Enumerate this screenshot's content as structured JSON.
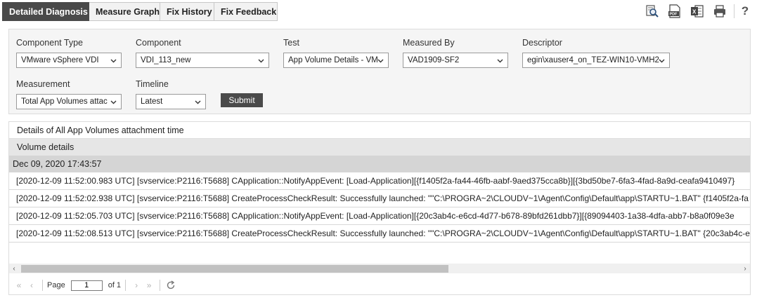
{
  "tabs": [
    {
      "label": "Detailed Diagnosis",
      "active": true
    },
    {
      "label": "Measure Graph",
      "active": false
    },
    {
      "label": "Fix History",
      "active": false
    },
    {
      "label": "Fix Feedback",
      "active": false
    }
  ],
  "toolbar": {
    "icons": [
      "search-report-icon",
      "pdf-icon",
      "excel-icon",
      "print-icon",
      "help-icon"
    ],
    "help_label": "?"
  },
  "filters": {
    "component_type": {
      "label": "Component Type",
      "value": "VMware vSphere VDI"
    },
    "component": {
      "label": "Component",
      "value": "VDI_113_new"
    },
    "test": {
      "label": "Test",
      "value": "App Volume Details - VM"
    },
    "measured_by": {
      "label": "Measured By",
      "value": "VAD1909-SF2"
    },
    "descriptor": {
      "label": "Descriptor",
      "value": "egin\\xauser4_on_TEZ-WIN10-VMH2"
    },
    "measurement": {
      "label": "Measurement",
      "value": "Total App Volumes attac"
    },
    "timeline": {
      "label": "Timeline",
      "value": "Latest"
    },
    "submit_label": "Submit"
  },
  "results": {
    "title": "Details of All App Volumes attachment time",
    "column_header": "Volume details",
    "group_label": "Dec 09, 2020 17:43:57",
    "rows": [
      "[2020-12-09 11:52:00.983 UTC] [svservice:P2116:T5688] CApplication::NotifyAppEvent: [Load-Application][{f1405f2a-fa44-46fb-aabf-9aed375cca8b}][{3bd50be7-6fa3-4fad-8a9d-ceafa9410497}",
      "[2020-12-09 11:52:02.938 UTC] [svservice:P2116:T5688] CreateProcessCheckResult: Successfully launched: \"\"C:\\PROGRA~2\\CLOUDV~1\\Agent\\Config\\Default\\app\\STARTU~1.BAT\" {f1405f2a-fa",
      "[2020-12-09 11:52:05.703 UTC] [svservice:P2116:T5688] CApplication::NotifyAppEvent: [Load-Application][{20c3ab4c-e6cd-4d77-b678-89bfd261dbb7}][{89094403-1a38-4dfa-abb7-b8a0f09e3e",
      "[2020-12-09 11:52:08.513 UTC] [svservice:P2116:T5688] CreateProcessCheckResult: Successfully launched: \"\"C:\\PROGRA~2\\CLOUDV~1\\Agent\\Config\\Default\\app\\STARTU~1.BAT\" {20c3ab4c-e"
    ]
  },
  "pager": {
    "page_label": "Page",
    "page_value": "1",
    "of_label": "of 1"
  }
}
